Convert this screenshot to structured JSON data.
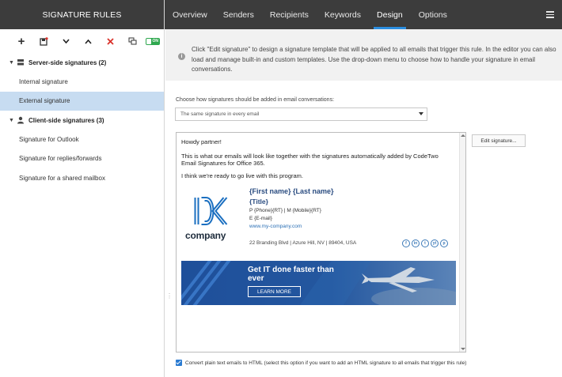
{
  "sidebar": {
    "title": "SIGNATURE RULES",
    "toolbar": {
      "add": "+",
      "toggle_label": "ON"
    },
    "groups": [
      {
        "label": "Server-side signatures (2)",
        "items": [
          "Internal signature",
          "External signature"
        ]
      },
      {
        "label": "Client-side signatures (3)",
        "items": [
          "Signature for Outlook",
          "Signature for replies/forwards",
          "Signature for a shared mailbox"
        ]
      }
    ]
  },
  "nav": {
    "tabs": [
      "Overview",
      "Senders",
      "Recipients",
      "Keywords",
      "Design",
      "Options"
    ],
    "active": "Design"
  },
  "info": {
    "line1": "Click \"Edit signature\" to design a signature template that will be applied to all emails that trigger this rule. In the editor you can also",
    "line2": "load and manage built-in and custom templates. Use the drop-down menu to choose how to handle your signature in email",
    "line3": "conversations."
  },
  "design": {
    "mode_label": "Choose how signatures should be added in email conversations:",
    "mode_value": "The same signature in every email",
    "edit_button": "Edit signature..."
  },
  "preview": {
    "greeting": "Howdy partner!",
    "body1": "This is what our emails will look like together with the signatures automatically added by CodeTwo",
    "body2": "Email Signatures for Office 365.",
    "body3": "I think we're ready to go live with this program.",
    "logo_word": "company",
    "name": "{First name} {Last name}",
    "title": "{Title}",
    "phones": "P {Phone}{RT} | M {Mobile}{RT}",
    "email": "E {E-mail}",
    "web": "www.my-company.com",
    "address": "22 Branding Blvd | Azure Hill, NV | 89404, USA",
    "socials": [
      "f",
      "in",
      "t",
      "yt",
      "p"
    ],
    "banner_title": "Get IT done faster than ever",
    "banner_button": "LEARN MORE"
  },
  "footer": {
    "convert_label": "Convert plain text emails to HTML (select this option if you want to add an HTML signature to all emails that trigger this rule)",
    "convert_checked": true
  },
  "colors": {
    "header_bg": "#3c3c3c",
    "accent": "#2a8de0",
    "selection": "#c7dcf1",
    "banner": "#1e4f9a"
  }
}
